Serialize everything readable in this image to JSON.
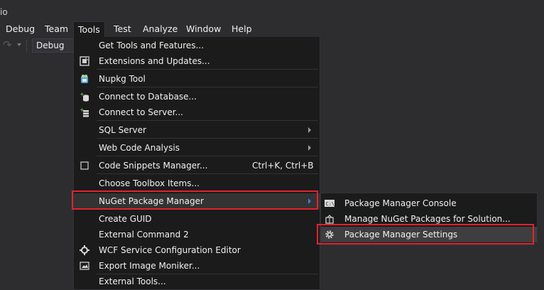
{
  "window": {
    "title_fragment": "io"
  },
  "menubar": {
    "items": [
      {
        "label": "Debug"
      },
      {
        "label": "Team"
      },
      {
        "label": "Tools"
      },
      {
        "label": "Test"
      },
      {
        "label": "Analyze"
      },
      {
        "label": "Window"
      },
      {
        "label": "Help"
      }
    ]
  },
  "toolbar": {
    "configuration": "Debug"
  },
  "tools_menu": {
    "items": [
      {
        "label": "Get Tools and Features...",
        "icon": ""
      },
      {
        "label": "Extensions and Updates...",
        "icon": "extensions-icon"
      },
      {
        "label": "Nupkg Tool",
        "icon": "nupkg-icon"
      },
      {
        "label": "Connect to Database...",
        "icon": "connect-database-icon"
      },
      {
        "label": "Connect to Server...",
        "icon": "connect-server-icon"
      },
      {
        "label": "SQL Server",
        "icon": "",
        "submenu": true
      },
      {
        "label": "Web Code Analysis",
        "icon": "",
        "submenu": true
      },
      {
        "label": "Code Snippets Manager...",
        "icon": "checkbox-icon",
        "shortcut": "Ctrl+K, Ctrl+B"
      },
      {
        "label": "Choose Toolbox Items...",
        "icon": ""
      },
      {
        "label": "NuGet Package Manager",
        "icon": "",
        "submenu": true,
        "highlighted": true
      },
      {
        "label": "Create GUID",
        "icon": ""
      },
      {
        "label": "External Command 2",
        "icon": ""
      },
      {
        "label": "WCF Service Configuration Editor",
        "icon": "wcf-icon"
      },
      {
        "label": "Export Image Moniker...",
        "icon": "image-moniker-icon"
      },
      {
        "label": "External Tools...",
        "icon": ""
      }
    ]
  },
  "nuget_submenu": {
    "items": [
      {
        "label": "Package Manager Console",
        "icon": "console-icon"
      },
      {
        "label": "Manage NuGet Packages for Solution...",
        "icon": "packages-icon"
      },
      {
        "label": "Package Manager Settings",
        "icon": "gear-icon",
        "highlighted": true
      }
    ]
  },
  "colors": {
    "accent_highlight": "#e2232e",
    "menu_bg": "#1b1b1c",
    "chrome_bg": "#2d2d30"
  }
}
